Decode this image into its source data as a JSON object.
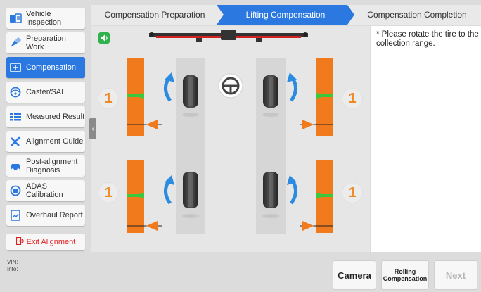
{
  "sidebar": {
    "items": [
      {
        "label": "Vehicle Inspection",
        "icon": "vehicle-inspection-icon"
      },
      {
        "label": "Preparation Work",
        "icon": "preparation-icon"
      },
      {
        "label": "Compensation",
        "icon": "compensation-icon",
        "active": true
      },
      {
        "label": "Caster/SAI",
        "icon": "caster-icon"
      },
      {
        "label": "Measured Result",
        "icon": "measured-result-icon"
      },
      {
        "label": "Alignment Guide",
        "icon": "alignment-guide-icon"
      },
      {
        "label": "Post-alignment Diagnosis",
        "icon": "post-diagnosis-icon"
      },
      {
        "label": "ADAS Calibration",
        "icon": "adas-icon"
      },
      {
        "label": "Overhaul Report",
        "icon": "overhaul-report-icon"
      }
    ],
    "exit_label": "Exit Alignment"
  },
  "steps": [
    {
      "label": "Compensation Preparation"
    },
    {
      "label": "Lifting Compensation",
      "active": true
    },
    {
      "label": "Compensation Completion"
    }
  ],
  "instruction": "* Please rotate the tire to the collection range.",
  "gauges": {
    "front_left": "1",
    "front_right": "1",
    "rear_left": "1",
    "rear_right": "1"
  },
  "footer": {
    "vin_label": "VIN:",
    "info_label": "Info:",
    "camera_label": "Camera",
    "rolling_label": "Rolling Compensation",
    "next_label": "Next"
  },
  "colors": {
    "accent": "#2a78e0",
    "gauge_orange": "#f07a1c",
    "gauge_green": "#3cc83c",
    "exit_red": "#e02020"
  }
}
